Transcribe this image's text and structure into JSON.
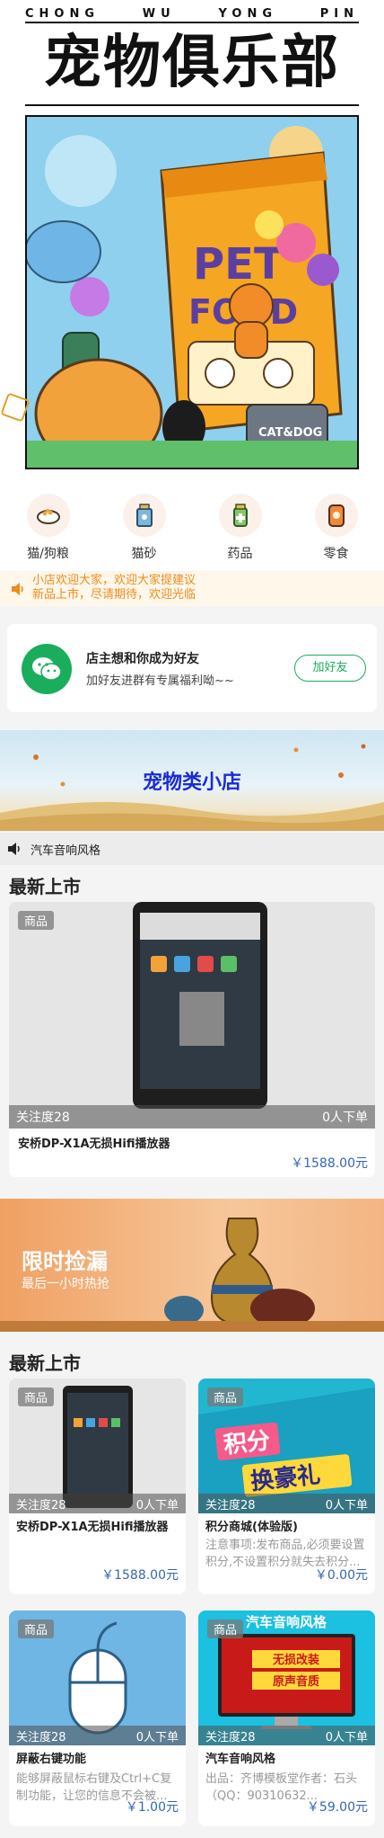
{
  "header": {
    "pinyin": [
      "CHONG",
      "WU",
      "YONG",
      "PIN"
    ],
    "title": "宠物俱乐部"
  },
  "categories": [
    {
      "label": "猫/狗粮",
      "icon": "pet-food-bowl-icon"
    },
    {
      "label": "猫砂",
      "icon": "cat-litter-icon"
    },
    {
      "label": "药品",
      "icon": "medicine-icon"
    },
    {
      "label": "零食",
      "icon": "snack-icon"
    }
  ],
  "notice": {
    "line1": "小店欢迎大家，欢迎大家提建议",
    "line2": "新品上市，尽请期待，欢迎光临"
  },
  "friend_card": {
    "title": "店主想和你成为好友",
    "subtitle": "加好友进群有专属福利呦~~",
    "button": "加好友"
  },
  "shop_banner": {
    "title": "宠物类小店"
  },
  "audio_bar": {
    "text": "汽车音响风格"
  },
  "section1": {
    "title": "最新上市",
    "product": {
      "badge": "商品",
      "attention": "关注度28",
      "orders": "0人下单",
      "name": "安桥DP-X1A无损Hifi播放器",
      "price": "￥1588.00元"
    }
  },
  "promo": {
    "title": "限时捡漏",
    "subtitle": "最后一小时热抢"
  },
  "section2": {
    "title": "最新上市",
    "products": [
      {
        "badge": "商品",
        "attention": "关注度28",
        "orders": "0人下单",
        "name": "安桥DP-X1A无损Hifi播放器",
        "desc": "",
        "price": "￥1588.00元"
      },
      {
        "badge": "商品",
        "attention": "关注度28",
        "orders": "0人下单",
        "name": "积分商城(体验版)",
        "desc": "注意事项:发布商品,必须要设置积分,不设置积分就失去积分...",
        "price": "￥0.00元",
        "img_text1": "积分",
        "img_text2": "换豪礼"
      },
      {
        "badge": "商品",
        "attention": "关注度28",
        "orders": "0人下单",
        "name": "屏蔽右键功能",
        "desc": "能够屏蔽鼠标右键及Ctrl+C复制功能，让您的信息不会被...",
        "price": "￥1.00元"
      },
      {
        "badge": "商品",
        "attention": "关注度28",
        "orders": "0人下单",
        "name": "汽车音响风格",
        "desc": "出品：齐博模板堂作者：石头（QQ：90310632...",
        "price": "￥59.00元",
        "img_title": "汽车音响风格",
        "img_text1": "无损改装",
        "img_text2": "原声音质"
      }
    ]
  },
  "colors": {
    "accent_green": "#1aad5b",
    "price_blue": "#3367b3",
    "notice_orange": "#f08a1b",
    "shop_title_blue": "#1a2bd6"
  }
}
